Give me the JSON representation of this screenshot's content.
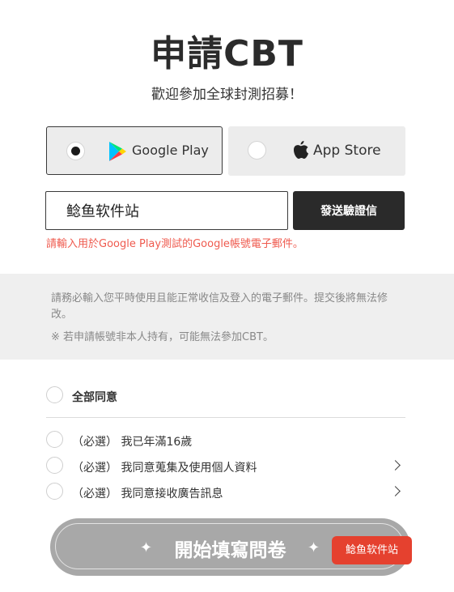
{
  "header": {
    "title": "申請CBT",
    "subtitle": "歡迎參加全球封測招募！"
  },
  "platforms": [
    {
      "label": "Google Play",
      "selected": true,
      "icon": "google-play-icon"
    },
    {
      "label": "App Store",
      "selected": false,
      "icon": "apple-icon"
    }
  ],
  "email": {
    "value": "鲶鱼软件站",
    "send_label": "發送驗證信",
    "hint": "請輸入用於Google Play測試的Google帳號電子郵件。"
  },
  "notice": {
    "line1": "請務必輸入您平時使用且能正常收信及登入的電子郵件。提交後將無法修改。",
    "line2": "※ 若申請帳號非本人持有，可能無法參加CBT。"
  },
  "agreements": {
    "all_label": "全部同意",
    "items": [
      {
        "label": "（必選） 我已年滿16歲",
        "has_chevron": false
      },
      {
        "label": "（必選） 我同意蒐集及使用個人資料",
        "has_chevron": true
      },
      {
        "label": "（必選） 我同意接收廣告訊息",
        "has_chevron": true
      }
    ]
  },
  "cta": {
    "label": "開始填寫問卷",
    "sparkle": "✦"
  },
  "badge": {
    "label": "鲶鱼软件站"
  },
  "colors": {
    "hint": "#ef5a4e",
    "send_button": "#2a2a2a",
    "cta": "#a8a8a8",
    "badge": "#e5412f"
  }
}
